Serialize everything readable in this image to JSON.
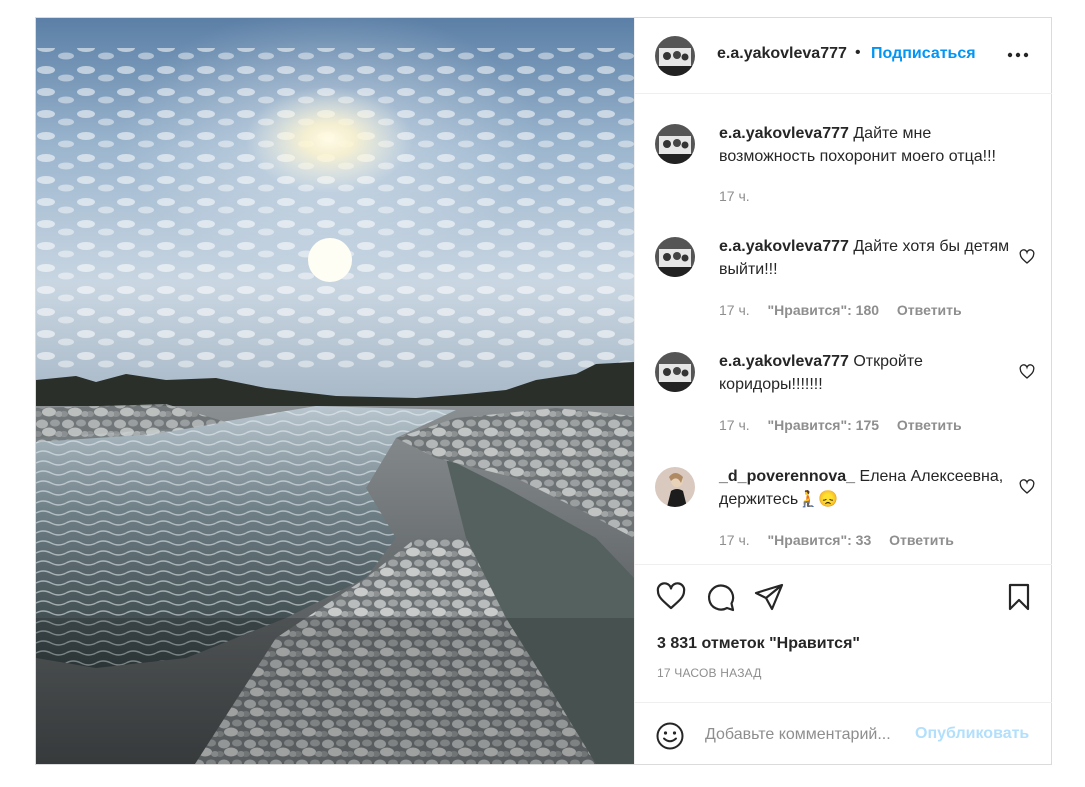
{
  "post": {
    "author": "e.a.yakovleva777",
    "follow_label": "Подписаться",
    "dot": "•",
    "more_icon": "more-horizontal-icon"
  },
  "comments": [
    {
      "user": "e.a.yakovleva777",
      "text": "Дайте мне возможность похоронит моего отца!!!",
      "time": "17 ч.",
      "likes": "",
      "reply": ""
    },
    {
      "user": "e.a.yakovleva777",
      "text": "Дайте хотя бы детям выйти!!!",
      "time": "17 ч.",
      "likes": "\"Нравится\": 180",
      "reply": "Ответить"
    },
    {
      "user": "e.a.yakovleva777",
      "text": "Откройте коридоры!!!!!!!",
      "time": "17 ч.",
      "likes": "\"Нравится\": 175",
      "reply": "Ответить"
    },
    {
      "user": "_d_poverennova_",
      "text": "Елена Алексеевна, держитесь🧎😞",
      "time": "17 ч.",
      "likes": "\"Нравится\": 33",
      "reply": "Ответить"
    }
  ],
  "actions": {
    "likes_count": "3 831 отметок \"Нравится\"",
    "posted_ago": "17 ЧАСОВ НАЗАД"
  },
  "add_comment": {
    "placeholder": "Добавьте комментарий...",
    "publish_label": "Опубликовать"
  },
  "colors": {
    "accent": "#0095f6",
    "publish_disabled": "#b2dffc",
    "secondary_text": "#8e8e8e"
  }
}
